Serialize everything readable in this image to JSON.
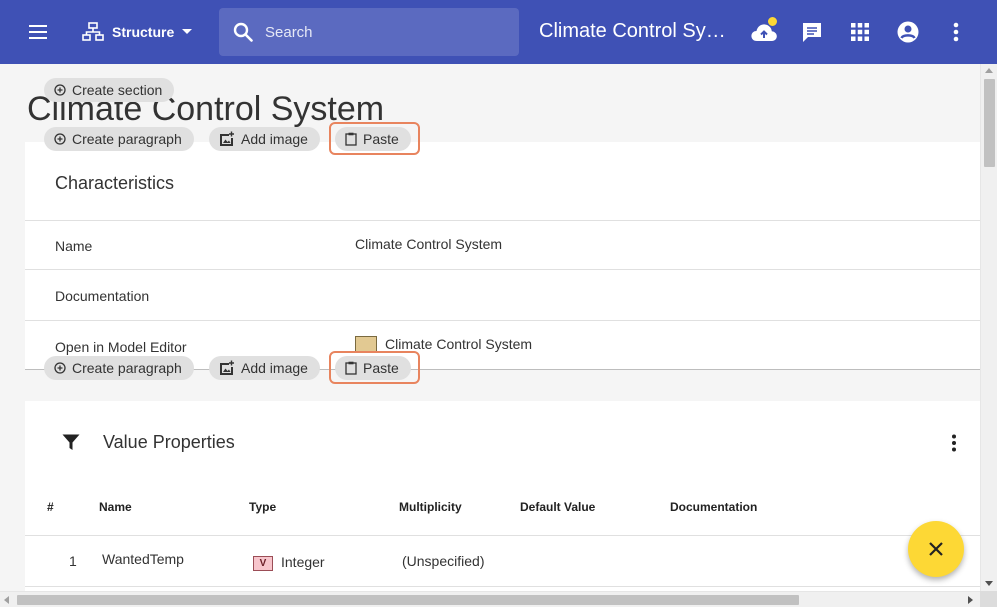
{
  "topbar": {
    "structure_label": "Structure",
    "search_placeholder": "Search",
    "doc_title": "Climate Control System"
  },
  "page": {
    "heading": "Climate Control System",
    "create_section": "Create section"
  },
  "toolbar_top": {
    "create_paragraph": "Create paragraph",
    "add_image": "Add image",
    "paste": "Paste"
  },
  "toolbar_mid": {
    "create_paragraph": "Create paragraph",
    "add_image": "Add image",
    "paste": "Paste"
  },
  "characteristics": {
    "title": "Characteristics",
    "rows": [
      {
        "label": "Name",
        "value": "Climate Control System"
      },
      {
        "label": "Documentation",
        "value": ""
      },
      {
        "label": "Open in Model Editor",
        "value": "Climate Control System"
      }
    ]
  },
  "value_properties": {
    "title": "Value Properties",
    "columns": [
      "#",
      "Name",
      "Type",
      "Multiplicity",
      "Default Value",
      "Documentation"
    ],
    "rows": [
      {
        "index": "1",
        "name": "WantedTemp",
        "type_badge": "V",
        "type": "Integer",
        "multiplicity": "(Unspecified)",
        "default": "",
        "documentation": ""
      }
    ]
  },
  "colors": {
    "appbar": "#3f51b5",
    "accent": "#fdd835",
    "highlight_outline": "#e8845e"
  }
}
